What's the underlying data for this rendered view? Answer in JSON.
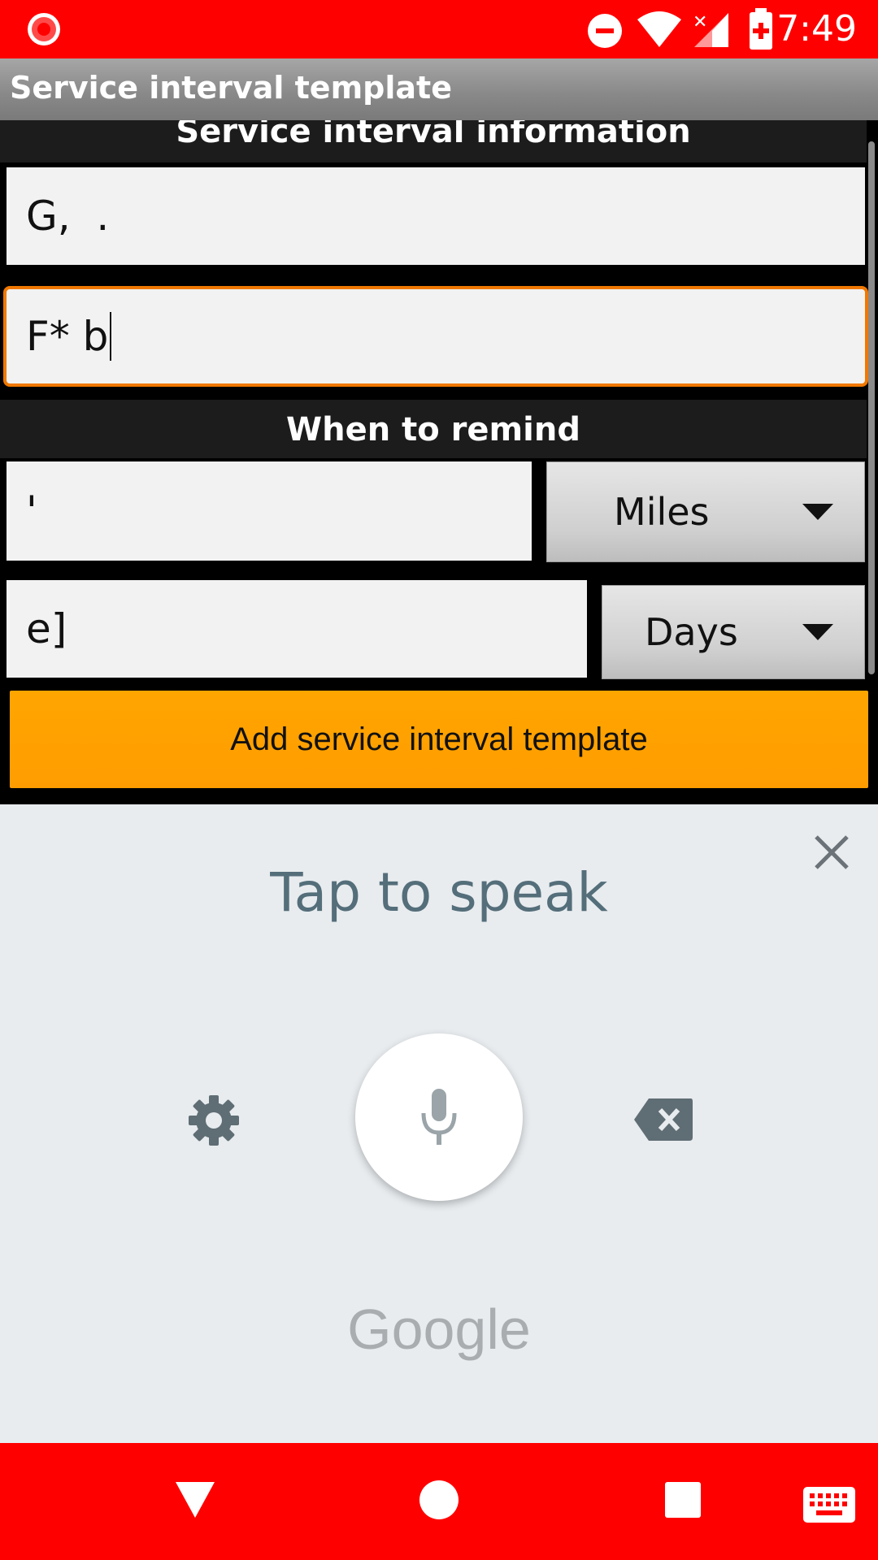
{
  "status_bar": {
    "time": "7:49"
  },
  "app_bar": {
    "title": "Service interval template"
  },
  "form": {
    "section_info": "Service interval information",
    "name_value": "G,  .",
    "notes_value": "F* b",
    "section_remind": "When to remind",
    "miles_value": "'",
    "miles_unit": "Miles",
    "days_value": "e]",
    "days_unit": "Days",
    "add_button": "Add service interval template"
  },
  "voice_input": {
    "prompt": "Tap to speak",
    "brand": "Google"
  },
  "icons": {
    "status_left": "recording-icon",
    "status_right": [
      "do-not-disturb-icon",
      "wifi-icon",
      "no-signal-icon",
      "battery-charging-icon"
    ],
    "voice": [
      "close-icon",
      "settings-icon",
      "microphone-icon",
      "backspace-icon"
    ],
    "nav": [
      "back-icon",
      "home-icon",
      "recents-icon",
      "keyboard-icon"
    ]
  },
  "colors": {
    "system_bars": "#ff0000",
    "accent": "#ffa500",
    "focus_border": "#f07800",
    "voice_panel": "#e8ecef",
    "voice_text": "#546e7a"
  }
}
